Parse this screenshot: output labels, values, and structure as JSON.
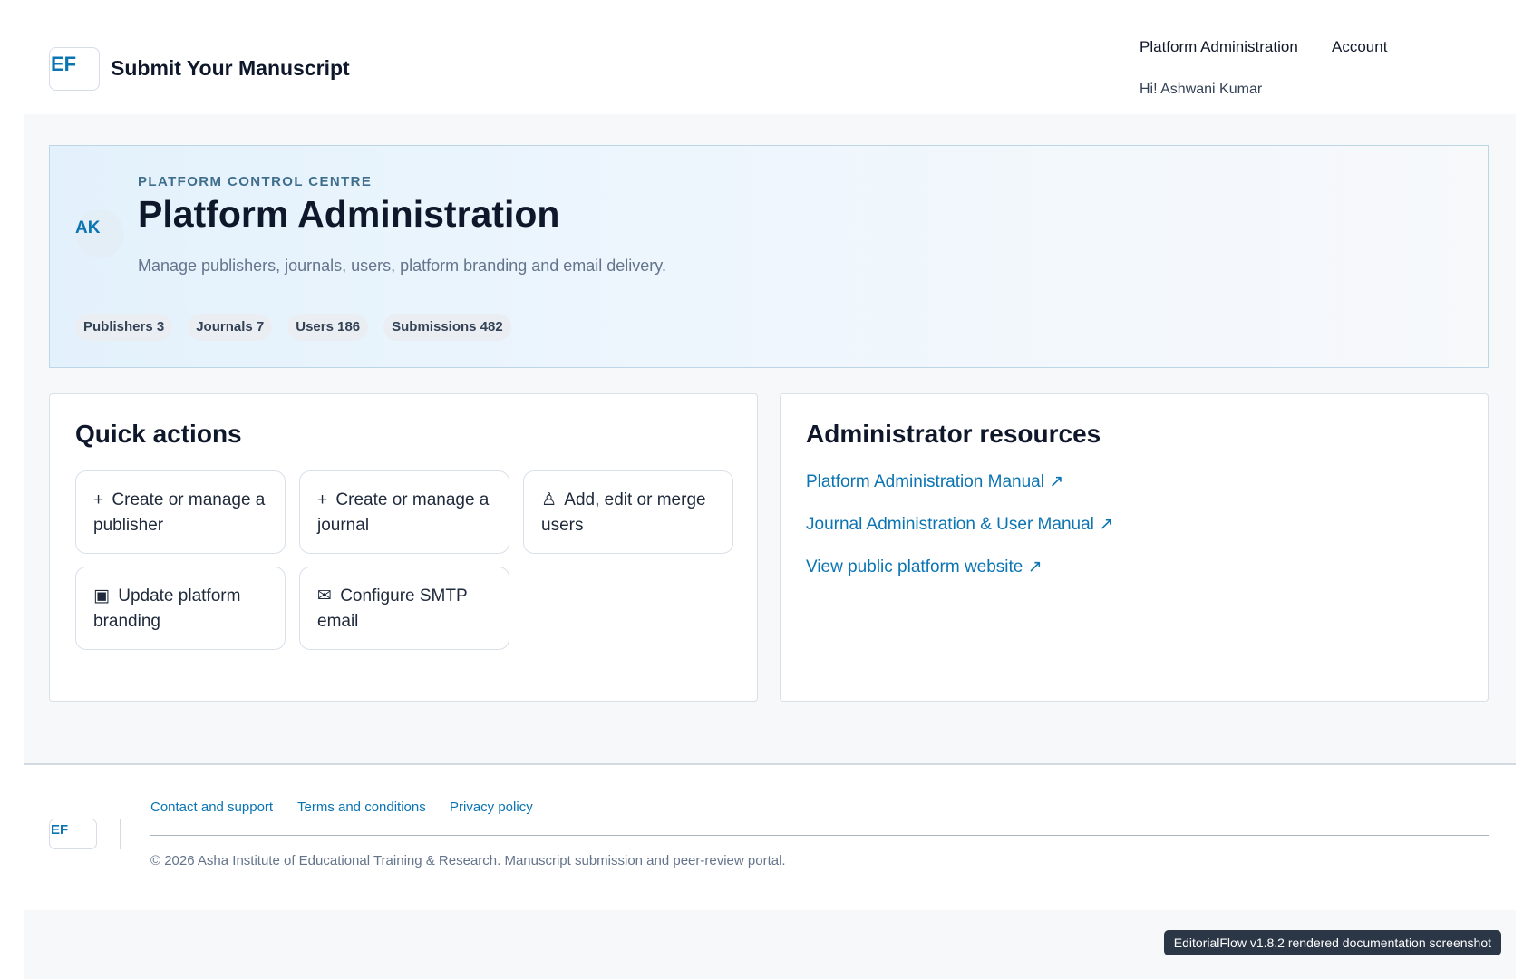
{
  "header": {
    "logo_text": "EF",
    "site_title": "Submit Your Manuscript",
    "nav": [
      "Platform Administration",
      "Account"
    ],
    "greeting": "Hi! Ashwani Kumar"
  },
  "hero": {
    "avatar_initials": "AK",
    "kicker": "PLATFORM CONTROL CENTRE",
    "title": "Platform Administration",
    "description": "Manage publishers, journals, users, platform branding and email delivery.",
    "stats": [
      "Publishers 3",
      "Journals 7",
      "Users 186",
      "Submissions 482"
    ]
  },
  "quick_actions": {
    "title": "Quick actions",
    "items": [
      {
        "icon": "+",
        "icon_name": "plus-icon",
        "label": "Create or manage a publisher"
      },
      {
        "icon": "+",
        "icon_name": "plus-icon",
        "label": "Create or manage a journal"
      },
      {
        "icon": "♙",
        "icon_name": "user-icon",
        "label": "Add, edit or merge users"
      },
      {
        "icon": "▣",
        "icon_name": "branding-icon",
        "label": "Update platform branding"
      },
      {
        "icon": "✉",
        "icon_name": "mail-icon",
        "label": "Configure SMTP email"
      }
    ]
  },
  "resources": {
    "title": "Administrator resources",
    "links": [
      "Platform Administration Manual ↗",
      "Journal Administration & User Manual ↗",
      "View public platform website ↗"
    ]
  },
  "footer": {
    "logo_text": "EF",
    "links": [
      "Contact and support",
      "Terms and conditions",
      "Privacy policy"
    ],
    "copyright": "© 2026 Asha Institute of Educational Training & Research. Manuscript submission and peer-review portal."
  },
  "version_badge": "EditorialFlow v1.8.2 rendered documentation screenshot",
  "colors": {
    "accent": "#0b74b3",
    "text": "#0f172a",
    "muted": "#64748b",
    "background": "#f6f8fa"
  }
}
